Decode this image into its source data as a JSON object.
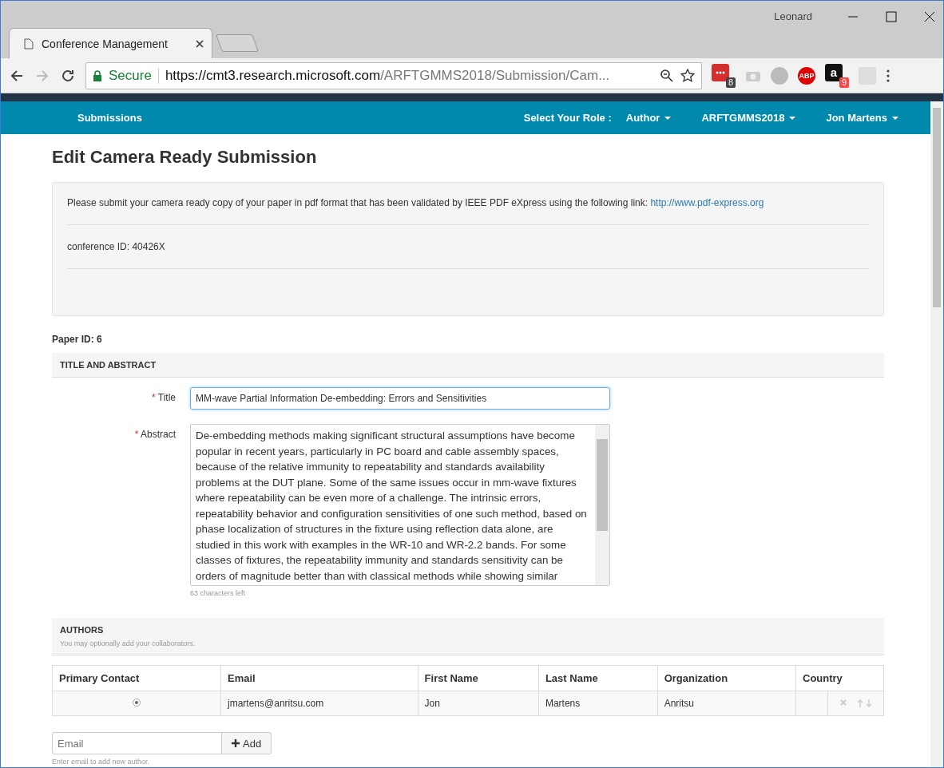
{
  "browser": {
    "user": "Leonard",
    "tab": {
      "title": "Conference Management"
    },
    "address": {
      "secure_label": "Secure",
      "url_host": "https://cmt3.research.microsoft.com",
      "url_path": "/ARFTGMMS2018/Submission/Cam..."
    },
    "extensions": [
      {
        "kind": "counter",
        "badge": "8",
        "color": "#d32f2f"
      },
      {
        "kind": "camera"
      },
      {
        "kind": "circle"
      },
      {
        "kind": "abp",
        "label": "ABP"
      },
      {
        "kind": "amazon",
        "label": "a",
        "badge": "9"
      },
      {
        "kind": "pocket"
      }
    ]
  },
  "navbar": {
    "left": "Submissions",
    "role_label": "Select Your Role :",
    "menus": [
      "Author",
      "ARFTGMMS2018",
      "Jon Martens"
    ]
  },
  "page": {
    "heading": "Edit Camera Ready Submission",
    "notice": {
      "text": "Please submit your camera ready copy of your paper in pdf format that has been validated by IEEE PDF eXpress using the following link: ",
      "link": "http://www.pdf-express.org",
      "conference_id": "conference ID: 40426X"
    },
    "paper_id": "Paper ID: 6",
    "title_section": {
      "header": "TITLE AND ABSTRACT",
      "required_mark": "*",
      "title_label": "Title",
      "title_value": "MM-wave Partial Information De-embedding: Errors and Sensitivities",
      "abstract_label": "Abstract",
      "abstract_value": "De-embedding methods making significant structural assumptions have become popular in recent years, particularly in PC board and cable assembly spaces, because of the relative immunity to repeatability and standards availability problems at the DUT plane.  Some of the same issues occur in mm-wave fixtures where repeatability can be even more of a challenge.  The intrinsic errors, repeatability behavior and configuration sensitivities of one such method, based on phase localization of structures in the fixture using reflection data alone, are studied in this work with examples in the WR-10 and WR-2.2 bands.  For some classes of fixtures, the repeatability immunity and standards sensitivity can be orders of magnitude better than with classical methods while showing similar",
      "chars_left": "63 characters left"
    },
    "authors": {
      "header": "AUTHORS",
      "hint": "You may optionally add your collaborators.",
      "columns": [
        "Primary Contact",
        "Email",
        "First Name",
        "Last Name",
        "Organization",
        "Country"
      ],
      "rows": [
        {
          "selected": true,
          "email": "jmartens@anritsu.com",
          "first": "Jon",
          "last": "Martens",
          "org": "Anritsu"
        }
      ],
      "email_placeholder": "Email",
      "add_label": "Add",
      "add_hint": "Enter email to add new author."
    }
  }
}
